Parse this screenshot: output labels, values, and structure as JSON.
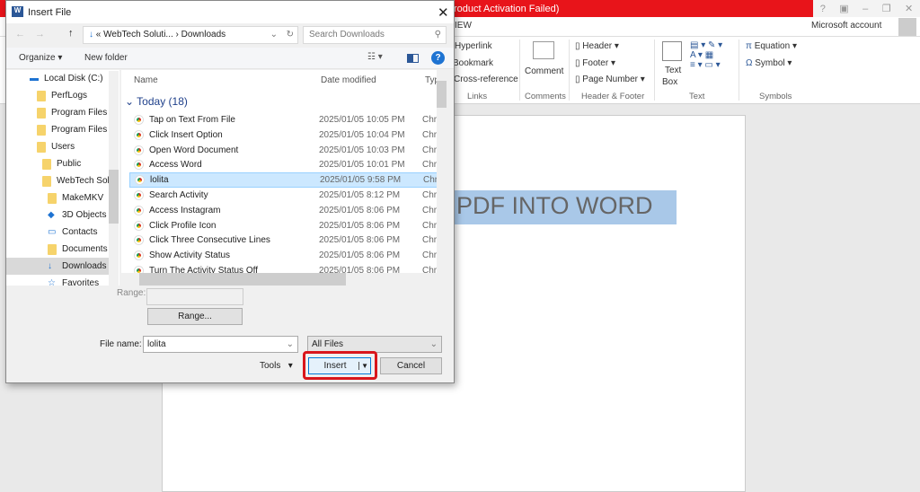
{
  "word": {
    "title": "roduct Activation Failed)",
    "tab_partial": "IEW",
    "account": "Microsoft account",
    "ribbon": {
      "links": [
        "Hyperlink",
        "Bookmark",
        "Cross-reference"
      ],
      "comment": "Comment",
      "header": "Header",
      "footer": "Footer",
      "page_number": "Page Number",
      "text_box_1": "Text",
      "text_box_2": "Box",
      "equation": "Equation",
      "symbol": "Symbol",
      "groups": [
        "Links",
        "Comments",
        "Header & Footer",
        "Text",
        "Symbols"
      ]
    },
    "document_text": "PDF INTO WORD",
    "window_controls": [
      "?",
      "▣",
      "–",
      "❐",
      "✕"
    ]
  },
  "dialog": {
    "title": "Insert File",
    "breadcrumb": [
      "«",
      "WebTech Soluti...",
      "›",
      "Downloads"
    ],
    "search_placeholder": "Search Downloads",
    "organize": "Organize ▾",
    "new_folder": "New folder",
    "nav": [
      "Local Disk (C:)",
      "PerfLogs",
      "Program Files",
      "Program Files (",
      "Users",
      "Public",
      "WebTech Solu",
      "MakeMKV",
      "3D Objects",
      "Contacts",
      "Documents",
      "Downloads",
      "Favorites"
    ],
    "columns": [
      "Name",
      "Date modified",
      "Type"
    ],
    "group": "Today (18)",
    "files": [
      {
        "name": "Tap on Text From File",
        "date": "2025/01/05 10:05 PM",
        "type": "Chro"
      },
      {
        "name": "Click Insert Option",
        "date": "2025/01/05 10:04 PM",
        "type": "Chro"
      },
      {
        "name": "Open Word Document",
        "date": "2025/01/05 10:03 PM",
        "type": "Chro"
      },
      {
        "name": "Access Word",
        "date": "2025/01/05 10:01 PM",
        "type": "Chro"
      },
      {
        "name": "lolita",
        "date": "2025/01/05 9:58 PM",
        "type": "Chro"
      },
      {
        "name": "Search Activity",
        "date": "2025/01/05 8:12 PM",
        "type": "Chro"
      },
      {
        "name": "Access Instagram",
        "date": "2025/01/05 8:06 PM",
        "type": "Chro"
      },
      {
        "name": "Click Profile Icon",
        "date": "2025/01/05 8:06 PM",
        "type": "Chro"
      },
      {
        "name": "Click Three Consecutive Lines",
        "date": "2025/01/05 8:06 PM",
        "type": "Chro"
      },
      {
        "name": "Show Activity Status",
        "date": "2025/01/05 8:06 PM",
        "type": "Chro"
      },
      {
        "name": "Turn The Activity Status Off",
        "date": "2025/01/05 8:06 PM",
        "type": "Chro"
      }
    ],
    "range_label": "Range:",
    "range_button": "Range...",
    "file_name_label": "File name:",
    "file_name_value": "lolita",
    "file_type": "All Files",
    "tools": "Tools",
    "insert": "Insert",
    "cancel": "Cancel"
  },
  "colors": {
    "title_red": "#e8141a",
    "highlight": "#a9c8e8",
    "selection": "#cce8ff",
    "callout": "#d9161c"
  }
}
